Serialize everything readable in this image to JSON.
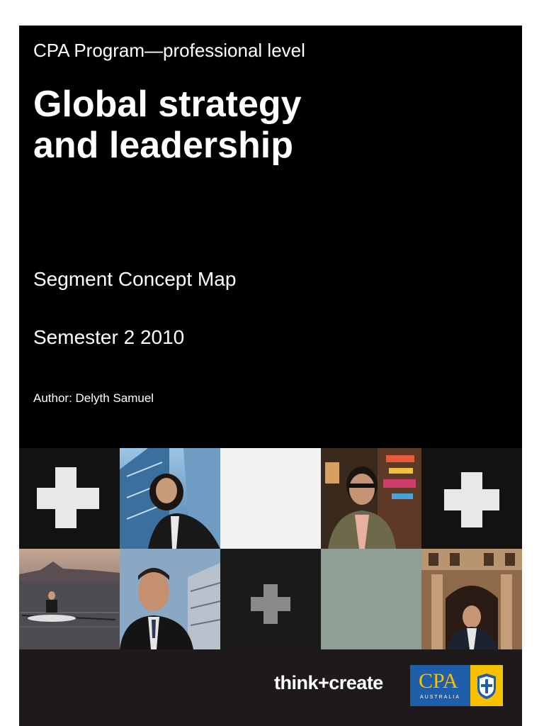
{
  "cover": {
    "program": "CPA Program—professional level",
    "title_line1": "Global strategy",
    "title_line2": "and leadership",
    "segment": "Segment Concept Map",
    "semester": "Semester 2 2010",
    "author": "Author: Delyth Samuel"
  },
  "grid": {
    "tiles": [
      {
        "kind": "plus",
        "bg": "#121212",
        "plus_color": "#e8e8e8",
        "plus_size": "large"
      },
      {
        "kind": "photo",
        "subject": "woman-skyscraper-photo"
      },
      {
        "kind": "blank",
        "bg": "#f2f2f2"
      },
      {
        "kind": "photo",
        "subject": "man-city-street-photo"
      },
      {
        "kind": "plus",
        "bg": "#121212",
        "plus_color": "#e8e8e8",
        "plus_size": "large"
      },
      {
        "kind": "photo",
        "subject": "rower-lake-photo"
      },
      {
        "kind": "photo",
        "subject": "man-building-photo"
      },
      {
        "kind": "plus",
        "bg": "#1a1a1a",
        "plus_color": "#8a8a8a",
        "plus_size": "small"
      },
      {
        "kind": "blank",
        "bg": "#8f9f96"
      },
      {
        "kind": "photo",
        "subject": "man-arch-building-photo"
      }
    ]
  },
  "footer": {
    "tagline": "think+create",
    "logo_main": "CPA",
    "logo_sub": "AUSTRALIA"
  },
  "colors": {
    "cover_bg": "#000000",
    "footer_bg": "#1e1a1c",
    "logo_blue": "#1f5ea8",
    "logo_yellow": "#f5c100"
  }
}
